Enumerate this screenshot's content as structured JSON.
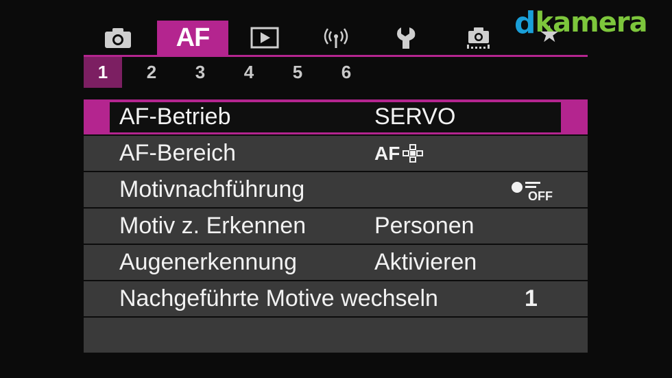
{
  "tabs": [
    {
      "id": "shooting",
      "icon": "camera-icon"
    },
    {
      "id": "af",
      "label": "AF",
      "active": true
    },
    {
      "id": "playback",
      "icon": "play-icon"
    },
    {
      "id": "wireless",
      "icon": "wireless-icon"
    },
    {
      "id": "setup",
      "icon": "wrench-icon"
    },
    {
      "id": "custom",
      "icon": "custom-functions-icon"
    },
    {
      "id": "mymenu",
      "icon": "star-icon"
    }
  ],
  "subtabs": [
    "1",
    "2",
    "3",
    "4",
    "5",
    "6"
  ],
  "active_subtab": "1",
  "menu": [
    {
      "label": "AF-Betrieb",
      "value": "SERVO",
      "selected": true
    },
    {
      "label": "AF-Bereich",
      "value_icon": "af-area-icon",
      "value": "AF"
    },
    {
      "label": "Motivnachführung",
      "value_icon": "tracking-off-icon",
      "value": "OFF"
    },
    {
      "label": "Motiv z. Erkennen",
      "value": "Personen"
    },
    {
      "label": "Augenerkennung",
      "value": "Aktivieren"
    },
    {
      "label": "Nachgeführte Motive wechseln",
      "value": "1"
    }
  ],
  "watermark": {
    "d": "d",
    "text": "kamera"
  },
  "colors": {
    "accent": "#b4258f",
    "accent_dark": "#7c1f62",
    "row_bg": "#3a3a3a",
    "logo_green": "#7dc63c",
    "logo_blue": "#1a9fd8"
  }
}
